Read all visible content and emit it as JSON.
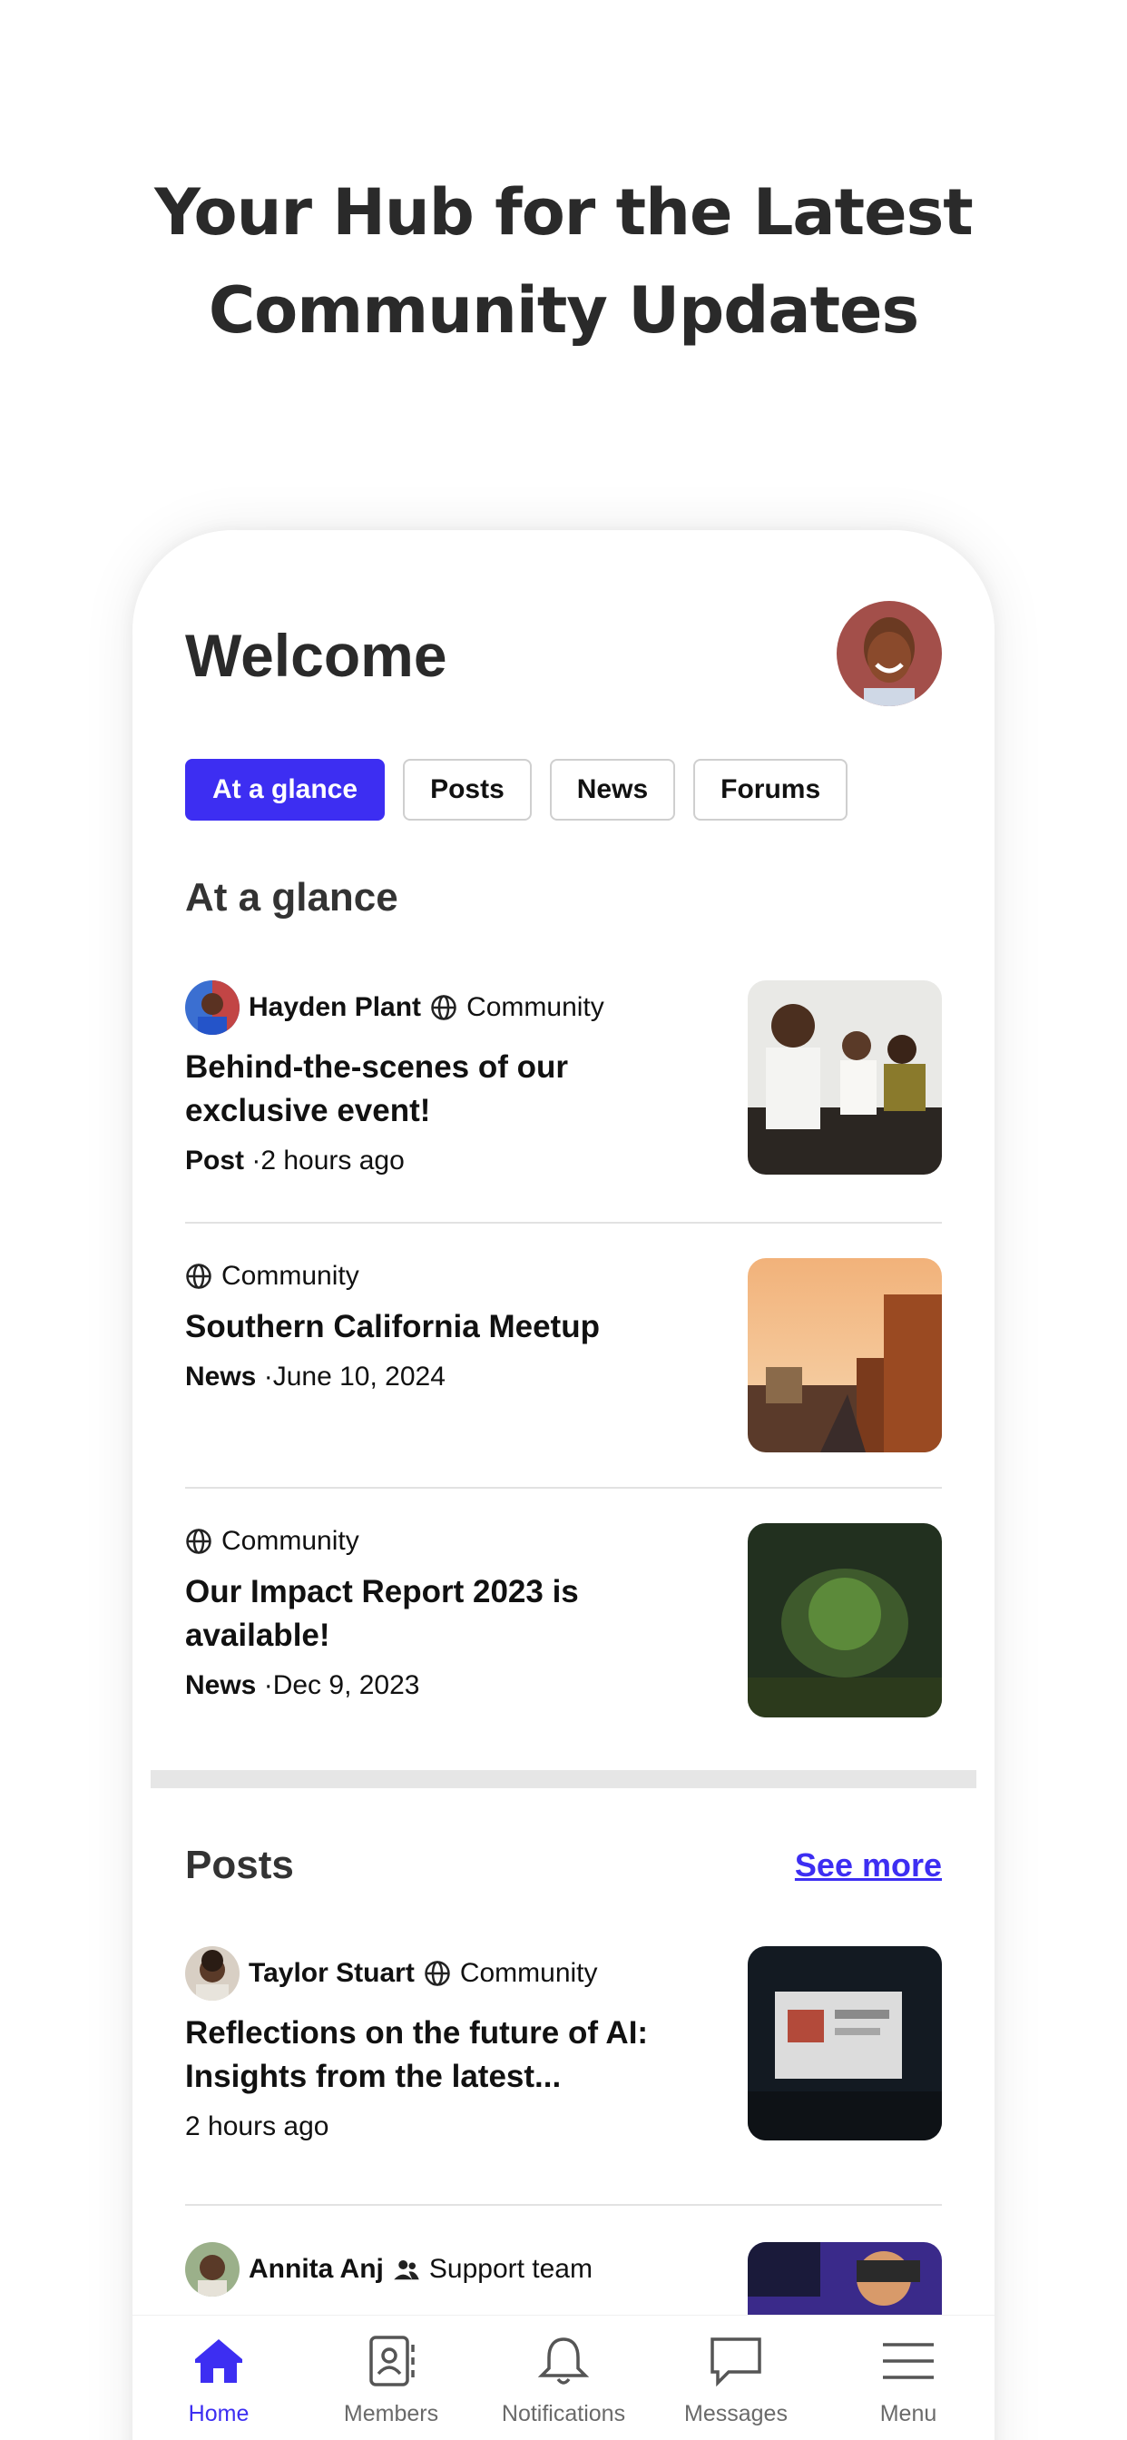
{
  "headline": {
    "line1": "Your Hub for the Latest",
    "line2": "Community Updates"
  },
  "header": {
    "title": "Welcome"
  },
  "tabs": [
    {
      "label": "At a glance",
      "active": true
    },
    {
      "label": "Posts",
      "active": false
    },
    {
      "label": "News",
      "active": false
    },
    {
      "label": "Forums",
      "active": false
    }
  ],
  "at_a_glance": {
    "title": "At a glance",
    "items": [
      {
        "author": "Hayden Plant",
        "group": "Community",
        "title": "Behind-the-scenes of our exclusive event!",
        "type": "Post",
        "time": "·2 hours ago"
      },
      {
        "author": "",
        "group": "Community",
        "title": "Southern California Meetup",
        "type": "News",
        "time": "·June 10, 2024"
      },
      {
        "author": "",
        "group": "Community",
        "title": "Our Impact Report 2023 is available!",
        "type": "News",
        "time": "·Dec 9, 2023"
      }
    ]
  },
  "posts": {
    "title": "Posts",
    "see_more": "See more",
    "items": [
      {
        "author": "Taylor Stuart",
        "group": "Community",
        "title": "Reflections on the future of AI: Insights from the latest...",
        "time": "2 hours ago"
      },
      {
        "author": "Annita Anj",
        "group": "Support team"
      }
    ]
  },
  "nav": [
    {
      "label": "Home",
      "icon": "home-icon",
      "active": true
    },
    {
      "label": "Members",
      "icon": "members-icon",
      "active": false
    },
    {
      "label": "Notifications",
      "icon": "bell-icon",
      "active": false
    },
    {
      "label": "Messages",
      "icon": "message-icon",
      "active": false
    },
    {
      "label": "Menu",
      "icon": "menu-icon",
      "active": false
    }
  ],
  "colors": {
    "accent": "#3d2ef2",
    "divider": "#e2e2e2"
  }
}
